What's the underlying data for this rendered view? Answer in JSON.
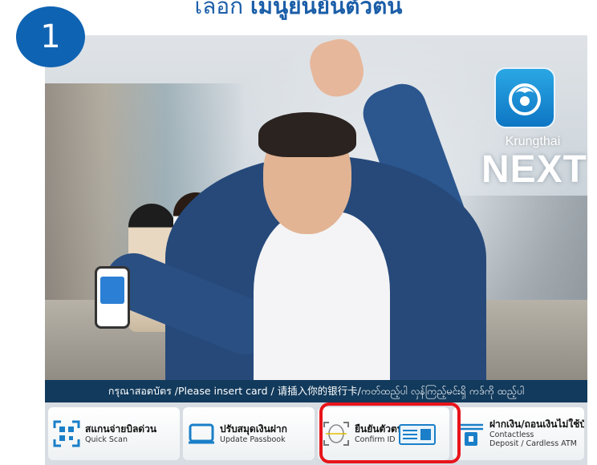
{
  "heading": {
    "prefix": "เลือก ",
    "emphasis": "เมนูยืนยันตัวตน"
  },
  "step": {
    "number": "1"
  },
  "brand": {
    "name": "Krungthai",
    "product": "NEXT"
  },
  "insert_card": {
    "text": "กรุณาสอดบัตร /Please insert card / 请插入你的银行卡/ကတ်ထည့်ပါ လှန်ကြည့်မင်းရှိ ကဒ်ကို ထည့်ပါ"
  },
  "menu": {
    "items": [
      {
        "th": "สแกนจ่ายบิลด่วน",
        "en": "Quick Scan",
        "icon": "qr-scan-icon"
      },
      {
        "th": "ปรับสมุดเงินฝาก",
        "en": "Update Passbook",
        "icon": "passbook-icon"
      },
      {
        "th": "ยืนยันตัวตน",
        "en": "Confirm ID",
        "icon": "face-scan-icon"
      },
      {
        "th": "ฝากเงิน/ถอนเงินไม่ใช้บัตร",
        "en1": "Contactless",
        "en2": "Deposit / Cardless ATM",
        "icon": "cash-deposit-icon"
      }
    ]
  },
  "colors": {
    "brand_blue": "#0f63b3",
    "bar_navy": "#123a5c",
    "highlight_red": "#e8141b"
  }
}
